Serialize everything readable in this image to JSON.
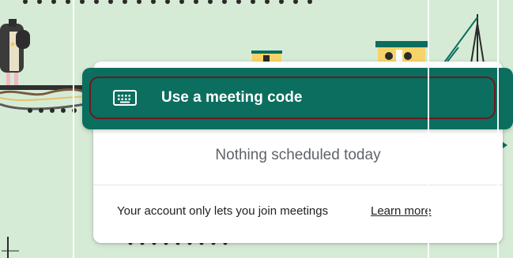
{
  "menu": {
    "meeting_code_label": "Use a meeting code",
    "icon": "keyboard-icon"
  },
  "schedule": {
    "empty_text": "Nothing scheduled today"
  },
  "footer": {
    "notice_text": "Your account only lets you join meetings",
    "learn_more_label": "Learn more"
  },
  "colors": {
    "background": "#d6ebd5",
    "menu_green": "#0b6e5f",
    "focus_ring": "#6b1a1f"
  }
}
